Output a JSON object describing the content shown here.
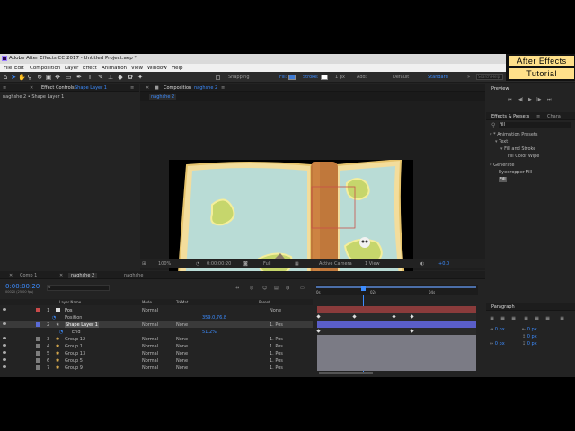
{
  "window": {
    "title": "Adobe After Effects CC 2017 - Untitled Project.aep *"
  },
  "menu": [
    "File",
    "Edit",
    "Composition",
    "Layer",
    "Effect",
    "Animation",
    "View",
    "Window",
    "Help"
  ],
  "toolbar": {
    "snapping": "Snapping",
    "fill": "Fill:",
    "stroke": "Stroke:",
    "stroke_px": "1 px",
    "add": "Add:",
    "workspace_default": "Default",
    "workspace_standard": "Standard",
    "workspace_chevron": "»",
    "search_placeholder": "Search Help"
  },
  "banner": {
    "line1": "After Effects",
    "line2": "Tutorial"
  },
  "left_panel": {
    "tab": "Effect Controls",
    "tab_target": "Shape Layer 1",
    "breadcrumb": "naghshe 2 • Shape Layer 1"
  },
  "comp_panel": {
    "tab": "Composition",
    "tab_target": "naghshe 2",
    "subtab": "naghshe 2",
    "zoom": "100%",
    "timecode": "0:00:00:20",
    "resolution": "Full",
    "camera": "Active Camera",
    "view": "1 View",
    "exposure": "+0.0"
  },
  "right_panel": {
    "preview_title": "Preview",
    "effects_tab": "Effects & Presets",
    "char_tab": "Chara",
    "search_value": "fill",
    "tree": [
      {
        "label": "* Animation Presets",
        "indent": 0
      },
      {
        "label": "Text",
        "indent": 1
      },
      {
        "label": "Fill and Stroke",
        "indent": 2
      },
      {
        "label": "Fill Color Wipe",
        "indent": 3
      },
      {
        "label": "Generate",
        "indent": 0
      },
      {
        "label": "Eyedropper Fill",
        "indent": 1
      },
      {
        "label": "Fill",
        "indent": 1
      }
    ],
    "paragraph_title": "Paragraph",
    "paragraph_values": [
      "0 px",
      "0 px",
      "0 px",
      "0 px",
      "0 px"
    ]
  },
  "timeline": {
    "tabs": [
      "Comp 1",
      "naghshe 2",
      "naghshe"
    ],
    "timecode": "0:00:00:20",
    "timecode_sub": "00020 (25.00 fps)",
    "columns": {
      "layer_name": "Layer Name",
      "mode": "Mode",
      "trkmat": "TrkMat",
      "parent": "Parent"
    },
    "ruler": [
      "0s",
      "02s",
      "04s"
    ],
    "rows": [
      {
        "num": "1",
        "name": "Pos",
        "mode": "Normal",
        "trkmat": "",
        "parent": "None",
        "type": "layer",
        "color": "#c94a4a"
      },
      {
        "num": "",
        "name": "Position",
        "value": "359.0,76.8",
        "type": "prop"
      },
      {
        "num": "2",
        "name": "Shape Layer 1",
        "mode": "Normal",
        "trkmat": "None",
        "parent": "1. Pos",
        "type": "layer",
        "color": "#5a6bd6",
        "selected": true
      },
      {
        "num": "",
        "name": "End",
        "value": "51.2%",
        "type": "prop"
      },
      {
        "num": "3",
        "name": "Group 12",
        "mode": "Normal",
        "trkmat": "None",
        "parent": "1. Pos",
        "type": "layer",
        "color": "#7d7d7d"
      },
      {
        "num": "4",
        "name": "Group 1",
        "mode": "Normal",
        "trkmat": "None",
        "parent": "1. Pos",
        "type": "layer",
        "color": "#7d7d7d"
      },
      {
        "num": "5",
        "name": "Group 13",
        "mode": "Normal",
        "trkmat": "None",
        "parent": "1. Pos",
        "type": "layer",
        "color": "#7d7d7d"
      },
      {
        "num": "6",
        "name": "Group 5",
        "mode": "Normal",
        "trkmat": "None",
        "parent": "1. Pos",
        "type": "layer",
        "color": "#7d7d7d"
      },
      {
        "num": "7",
        "name": "Group 9",
        "mode": "Normal",
        "trkmat": "None",
        "parent": "1. Pos",
        "type": "layer",
        "color": "#7d7d7d"
      }
    ]
  },
  "colors": {
    "accent": "#3c8cff",
    "timecode": "#3c8cff",
    "banner": "#ffe08a",
    "map_paper": "#f3dd9c",
    "map_water": "#b9dcd6"
  }
}
